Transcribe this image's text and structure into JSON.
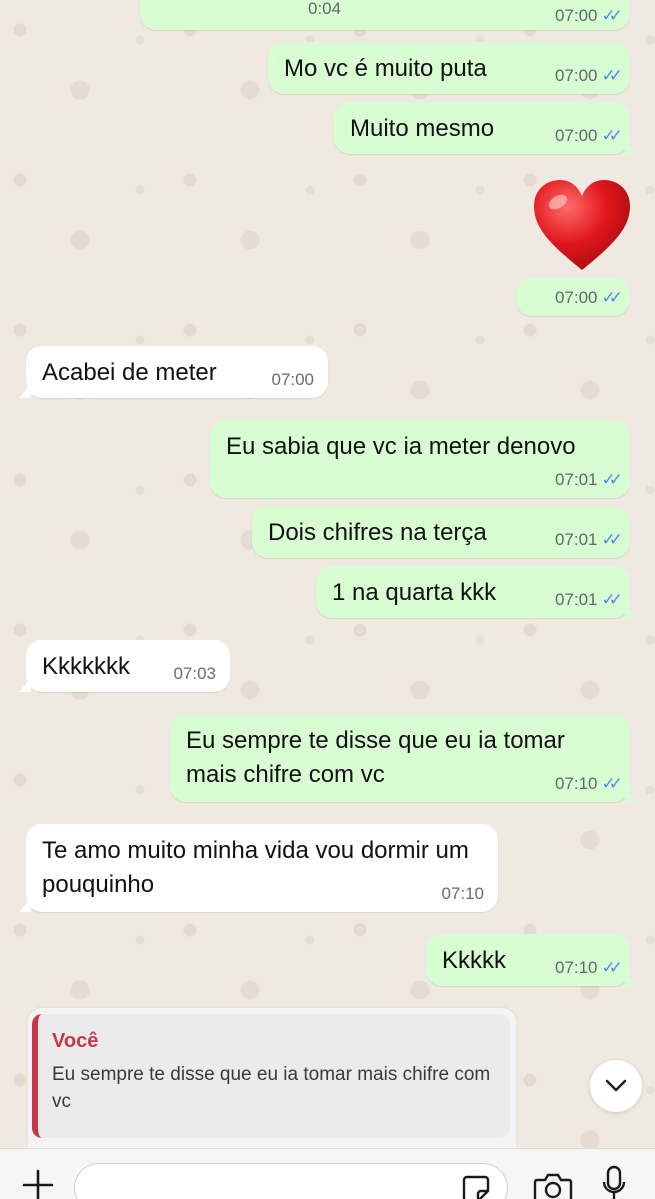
{
  "messages": [
    {
      "id": "m0",
      "dir": "out",
      "text": "0:04",
      "time": "07:00",
      "kind": "audio"
    },
    {
      "id": "m1",
      "dir": "out",
      "text": "Mo vc é muito puta",
      "time": "07:00"
    },
    {
      "id": "m2",
      "dir": "out",
      "text": "Muito mesmo",
      "time": "07:00"
    },
    {
      "id": "m3",
      "dir": "out",
      "text": "",
      "time": "07:00",
      "kind": "emoji-heart"
    },
    {
      "id": "m4",
      "dir": "in",
      "text": "Acabei de meter",
      "time": "07:00"
    },
    {
      "id": "m5",
      "dir": "out",
      "text": "Eu sabia que vc ia meter denovo",
      "time": "07:01"
    },
    {
      "id": "m6",
      "dir": "out",
      "text": "Dois chifres na terça",
      "time": "07:01"
    },
    {
      "id": "m7",
      "dir": "out",
      "text": "1 na quarta kkk",
      "time": "07:01"
    },
    {
      "id": "m8",
      "dir": "in",
      "text": "Kkkkkkk",
      "time": "07:03"
    },
    {
      "id": "m9",
      "dir": "out",
      "text": "Eu sempre te disse que eu ia tomar mais chifre com vc",
      "time": "07:10"
    },
    {
      "id": "m10",
      "dir": "in",
      "text": "Te amo muito minha vida vou dormir um pouquinho",
      "time": "07:10"
    },
    {
      "id": "m11",
      "dir": "out",
      "text": "Kkkkk",
      "time": "07:10"
    }
  ],
  "reply_preview": {
    "author": "Você",
    "text": "Eu sempre te disse que eu ia tomar mais chifre com vc"
  },
  "composer": {
    "placeholder": ""
  },
  "icons": {
    "attach": "plus-icon",
    "sticker": "sticker-icon",
    "camera": "camera-icon",
    "mic": "microphone-icon",
    "scroll": "chevron-down-icon",
    "read_receipt": "double-check-icon"
  },
  "colors": {
    "outgoing_bubble": "#d9fdd3",
    "incoming_bubble": "#ffffff",
    "read_ticks": "#4a90e2",
    "reply_accent": "#c9374b",
    "chat_background": "#efe9e1"
  }
}
